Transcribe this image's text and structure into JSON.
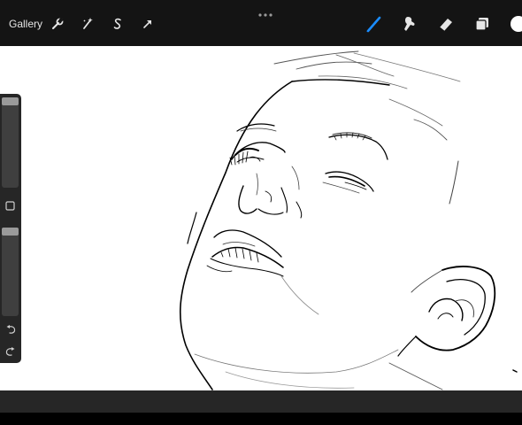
{
  "toolbar": {
    "gallery_label": "Gallery",
    "left_tools": [
      "wrench-icon",
      "magic-wand-icon",
      "selection-s-icon",
      "transform-arrow-icon"
    ],
    "right_tools": [
      "brush-icon",
      "smudge-icon",
      "eraser-icon",
      "layers-icon"
    ],
    "active_tool": "brush-icon",
    "accent_color": "#1a8cff",
    "current_color": "#ffffff"
  },
  "sidebar": {
    "brush_size": 0.0,
    "brush_opacity": 0.0,
    "modify_button_icon": "square-icon",
    "undo_icon": "undo-icon",
    "redo_icon": "redo-icon"
  }
}
